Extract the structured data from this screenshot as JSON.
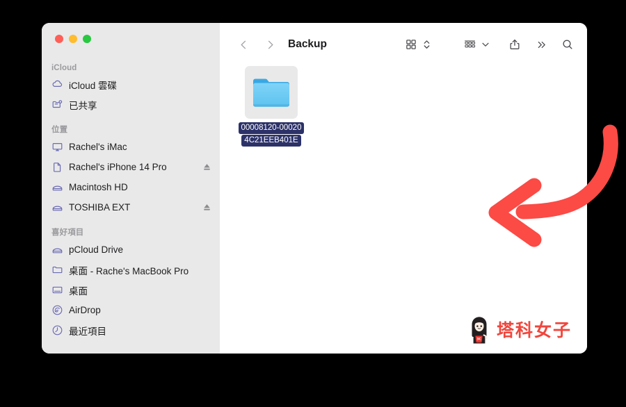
{
  "window": {
    "title": "Backup",
    "traffic_lights": [
      {
        "name": "close",
        "color": "#ff5f57"
      },
      {
        "name": "minimize",
        "color": "#febc2e"
      },
      {
        "name": "maximize",
        "color": "#28c840"
      }
    ]
  },
  "toolbar": {
    "back_label": "‹",
    "forward_label": "›",
    "title": "Backup",
    "view_icon": "grid-view-icon",
    "view_sort_icon": "chevron-up-down-icon",
    "group_icon": "group-by-icon",
    "group_chevron_icon": "chevron-down-icon",
    "share_icon": "share-icon",
    "more_icon": "double-chevron-right-icon",
    "search_icon": "search-icon"
  },
  "sidebar": {
    "sections": [
      {
        "title": "iCloud",
        "items": [
          {
            "label": "iCloud 雲碟",
            "icon": "icloud-cloud-icon",
            "eject": false
          },
          {
            "label": "已共享",
            "icon": "shared-folder-icon",
            "eject": false
          }
        ]
      },
      {
        "title": "位置",
        "items": [
          {
            "label": "Rachel's iMac",
            "icon": "imac-display-icon",
            "eject": false
          },
          {
            "label": "Rachel's  iPhone 14 Pro",
            "icon": "iphone-document-icon",
            "eject": true
          },
          {
            "label": "Macintosh HD",
            "icon": "hard-disk-icon",
            "eject": false
          },
          {
            "label": "TOSHIBA EXT",
            "icon": "external-disk-icon",
            "eject": true
          }
        ]
      },
      {
        "title": "喜好項目",
        "items": [
          {
            "label": "pCloud Drive",
            "icon": "hard-disk-icon",
            "eject": false
          },
          {
            "label": "桌面 - Rache's MacBook Pro",
            "icon": "folder-icon",
            "eject": false
          },
          {
            "label": "桌面",
            "icon": "desktop-icon",
            "eject": false
          },
          {
            "label": "AirDrop",
            "icon": "airdrop-icon",
            "eject": false
          },
          {
            "label": "最近項目",
            "icon": "clock-icon",
            "eject": false
          }
        ]
      }
    ]
  },
  "files": [
    {
      "name": "00008120-000204C21EEB401E",
      "name_line1": "00008120-00020",
      "name_line2": "4C21EEB401E",
      "type": "folder",
      "selected": true
    }
  ],
  "watermark": {
    "text": "塔科女子",
    "badge": "3C",
    "color": "#f0463c"
  },
  "annotation": {
    "type": "curved-arrow",
    "color": "#fc4a45",
    "direction": "left"
  }
}
